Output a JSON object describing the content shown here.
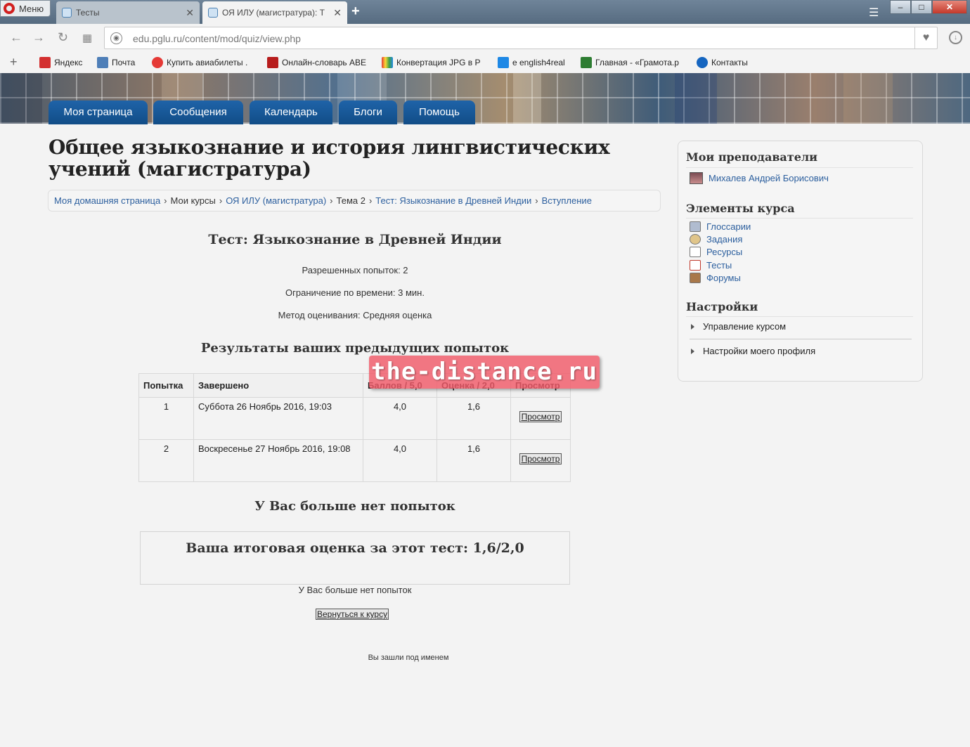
{
  "browser": {
    "menu_label": "Меню",
    "tabs": [
      {
        "title": "Тесты",
        "close": "✕"
      },
      {
        "title": "ОЯ ИЛУ (магистратура): Т",
        "close": "✕"
      }
    ],
    "new_tab": "+",
    "window_buttons": {
      "minimize": "–",
      "maximize": "□",
      "close": "✕"
    },
    "url": "edu.pglu.ru/content/mod/quiz/view.php",
    "bookmarks": [
      {
        "label": "Яндекс",
        "color": "#d32f2f"
      },
      {
        "label": "Почта",
        "color": "#4f7fb8"
      },
      {
        "label": "Купить авиабилеты .",
        "color": "#e53935"
      },
      {
        "label": "Онлайн-словарь АВЕ",
        "color": "#b71c1c"
      },
      {
        "label": "Конвертация JPG в P",
        "color": "#7cb342"
      },
      {
        "label": "e english4real",
        "color": "#1e88e5"
      },
      {
        "label": "Главная - «Грамота.р",
        "color": "#2e7d32"
      },
      {
        "label": "Контакты",
        "color": "#1565c0"
      }
    ]
  },
  "nav": {
    "items": [
      "Моя страница",
      "Сообщения",
      "Календарь",
      "Блоги",
      "Помощь"
    ]
  },
  "course_title": "Общее языкознание и история лингвистических учений (магистратура)",
  "breadcrumb": {
    "home": "Моя домашняя страница",
    "my_courses": "Мои курсы",
    "course": "ОЯ ИЛУ (магистратура)",
    "topic": "Тема 2",
    "quiz": "Тест: Языкознание в Древней Индии",
    "current": "Вступление",
    "separator": "›"
  },
  "quiz": {
    "title": "Тест: Языкознание в Древней Индии",
    "attempts_allowed": "Разрешенных попыток: 2",
    "time_limit": "Ограничение по времени: 3 мин.",
    "grading_method": "Метод оценивания: Средняя оценка",
    "results_heading": "Результаты ваших предыдущих попыток",
    "table_headers": [
      "Попытка",
      "Завершено",
      "Баллов / 5,0",
      "Оценка / 2,0",
      "Просмотр"
    ],
    "rows": [
      {
        "attempt": "1",
        "completed": "Суббота 26 Ноябрь 2016, 19:03",
        "points": "4,0",
        "grade": "1,6",
        "review": "Просмотр"
      },
      {
        "attempt": "2",
        "completed": "Воскресенье 27 Ноябрь 2016, 19:08",
        "points": "4,0",
        "grade": "1,6",
        "review": "Просмотр"
      }
    ],
    "no_more_heading": "У Вас больше нет попыток",
    "final_grade": "Ваша итоговая оценка за этот тест: 1,6/2,0",
    "no_more_text": "У Вас больше нет попыток",
    "back_button": "Вернуться к курсу",
    "logged_in_as": "Вы зашли под именем"
  },
  "watermark": "the-distance.ru",
  "sidebar": {
    "teachers_heading": "Мои преподаватели",
    "teacher_name": "Михалев Андрей Борисович",
    "elements_heading": "Элементы курса",
    "elements": [
      "Глоссарии",
      "Задания",
      "Ресурсы",
      "Тесты",
      "Форумы"
    ],
    "settings_heading": "Настройки",
    "settings": [
      "Управление курсом",
      "Настройки моего профиля"
    ]
  }
}
